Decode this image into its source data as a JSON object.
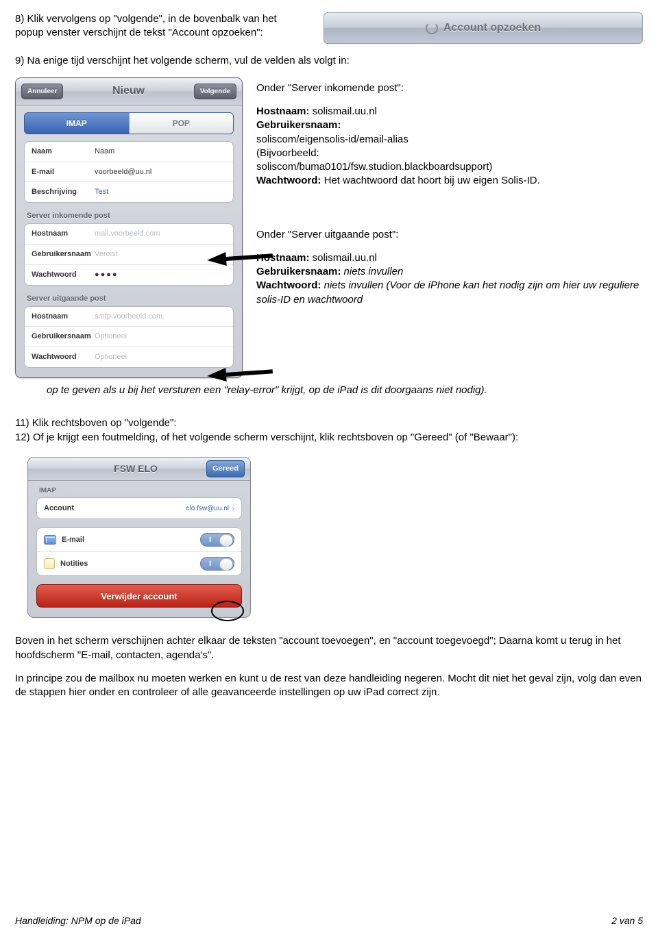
{
  "step8": "8) Klik vervolgens op \"volgende\", in de bovenbalk van het popup venster verschijnt de tekst \"Account opzoeken\":",
  "bar_lookup": "Account opzoeken",
  "step9": "9) Na enige tijd verschijnt het volgende scherm, vul de velden als volgt in:",
  "popup": {
    "cancel": "Annuleer",
    "title": "Nieuw",
    "next": "Volgende",
    "seg_imap": "IMAP",
    "seg_pop": "POP",
    "f_name_l": "Naam",
    "f_name_v": "Naam",
    "f_email_l": "E-mail",
    "f_email_v": "voorbeeld@uu.nl",
    "f_desc_l": "Beschrijving",
    "f_desc_v": "Test",
    "h_in": "Server inkomende post",
    "in_host_l": "Hostnaam",
    "in_host_ph": "mail.voorbeeld.com",
    "in_user_l": "Gebruikersnaam",
    "in_user_ph": "Vereist",
    "in_pw_l": "Wachtwoord",
    "in_pw_v": "●●●●",
    "h_out": "Server uitgaande post",
    "out_host_l": "Hostnaam",
    "out_host_ph": "smtp.voorbeeld.com",
    "out_user_l": "Gebruikersnaam",
    "out_user_ph": "Optioneel",
    "out_pw_l": "Wachtwoord",
    "out_pw_ph": "Optioneel"
  },
  "t_in_head": "Onder \"Server inkomende post\":",
  "t_in_host_l": "Hostnaam:",
  "t_in_host_v": " solismail.uu.nl",
  "t_in_user_l": "Gebruikersnaam:",
  "t_in_user_v1": "soliscom/eigensolis-id/email-alias",
  "t_in_user_v2": "(Bijvoorbeeld:",
  "t_in_user_v3": "soliscom/buma0101/fsw.studion.blackboardsupport)",
  "t_in_pw_l": "Wachtwoord:",
  "t_in_pw_v": " Het wachtwoord dat hoort bij uw eigen Solis-ID.",
  "t_out_head": "Onder \"Server uitgaande post\":",
  "t_out_host_l": "Hostnaam:",
  "t_out_host_v": " solismail.uu.nl",
  "t_out_user_l": "Gebruikersnaam:",
  "t_out_user_v": " niets invullen",
  "t_out_pw_l": "Wachtwoord:",
  "t_out_pw_v": " niets invullen (Voor de iPhone kan het nodig zijn om hier uw reguliere solis-ID en wachtwoord",
  "t_out_tail": "op te geven als u bij het versturen een \"relay-error\" krijgt, op de iPad is dit doorgaans niet nodig).",
  "step11": "11) Klik rechtsboven op \"volgende\":",
  "step12": "12) Of je krijgt een foutmelding, of het volgende scherm verschijnt, klik rechtsboven op \"Gereed\" (of \"Bewaar\"):",
  "panel2": {
    "title": "FSW ELO",
    "done": "Gereed",
    "h_imap": "IMAP",
    "acc_l": "Account",
    "acc_v": "elo.fsw@uu.nl",
    "mail_l": "E-mail",
    "notes_l": "Notities",
    "del": "Verwijder account"
  },
  "post1": "Boven in het scherm verschijnen achter elkaar de teksten \"account toevoegen\", en \"account toegevoegd\"; Daarna komt u terug in het hoofdscherm \"E-mail, contacten, agenda's\".",
  "post2": "In principe zou de mailbox nu moeten werken en kunt u de rest van deze handleiding negeren. Mocht dit niet het geval zijn, volg dan even de stappen hier onder en controleer of alle geavanceerde instellingen op uw iPad correct zijn.",
  "footer_l": "Handleiding: NPM op de iPad",
  "footer_r": "2 van 5"
}
